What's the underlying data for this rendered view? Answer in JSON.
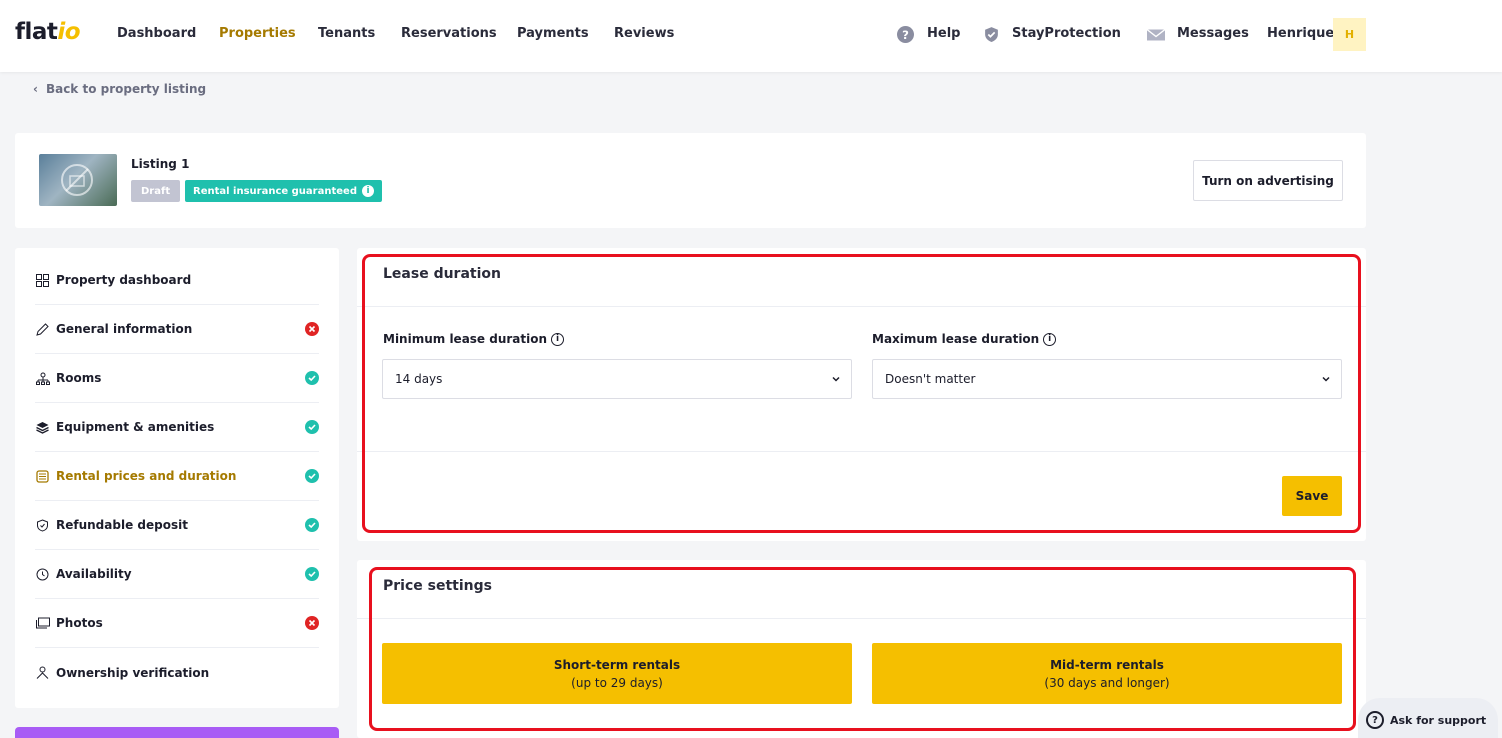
{
  "brand": {
    "name_main": "flat",
    "name_accent": "io",
    "accent_color": "#f5bf00"
  },
  "nav": {
    "items": [
      {
        "label": "Dashboard",
        "active": false
      },
      {
        "label": "Properties",
        "active": true
      },
      {
        "label": "Tenants",
        "active": false
      },
      {
        "label": "Reservations",
        "active": false
      },
      {
        "label": "Payments",
        "active": false
      },
      {
        "label": "Reviews",
        "active": false
      }
    ],
    "help_label": "Help",
    "protection_label": "StayProtection",
    "messages_label": "Messages",
    "user_name": "Henrique",
    "user_initial": "H"
  },
  "back_link": "Back to property listing",
  "listing": {
    "title": "Listing 1",
    "draft_badge": "Draft",
    "insurance_badge": "Rental insurance guaranteed",
    "advertise_button": "Turn on advertising"
  },
  "sidebar": {
    "items": [
      {
        "label": "Property dashboard",
        "icon": "grid-icon",
        "status": ""
      },
      {
        "label": "General information",
        "icon": "pencil-icon",
        "status": "error"
      },
      {
        "label": "Rooms",
        "icon": "rooms-icon",
        "status": "ok"
      },
      {
        "label": "Equipment & amenities",
        "icon": "layers-icon",
        "status": "ok"
      },
      {
        "label": "Rental prices and duration",
        "icon": "coins-icon",
        "status": "ok"
      },
      {
        "label": "Refundable deposit",
        "icon": "shield-icon",
        "status": "ok"
      },
      {
        "label": "Availability",
        "icon": "clock-icon",
        "status": "ok"
      },
      {
        "label": "Photos",
        "icon": "photos-icon",
        "status": "error"
      },
      {
        "label": "Ownership verification",
        "icon": "user-icon",
        "status": ""
      }
    ]
  },
  "lease": {
    "title": "Lease duration",
    "min_label": "Minimum lease duration",
    "min_value": "14 days",
    "max_label": "Maximum lease duration",
    "max_value": "Doesn't matter",
    "save_label": "Save"
  },
  "price": {
    "title": "Price settings",
    "short_line1": "Short-term rentals",
    "short_line2": "(up to 29 days)",
    "mid_line1": "Mid-term rentals",
    "mid_line2": "(30 days and longer)"
  },
  "support_label": "Ask for support",
  "colors": {
    "ok": "#1fc0ad",
    "error": "#e02424",
    "highlight": "#e8101e",
    "active": "#a57a00"
  }
}
